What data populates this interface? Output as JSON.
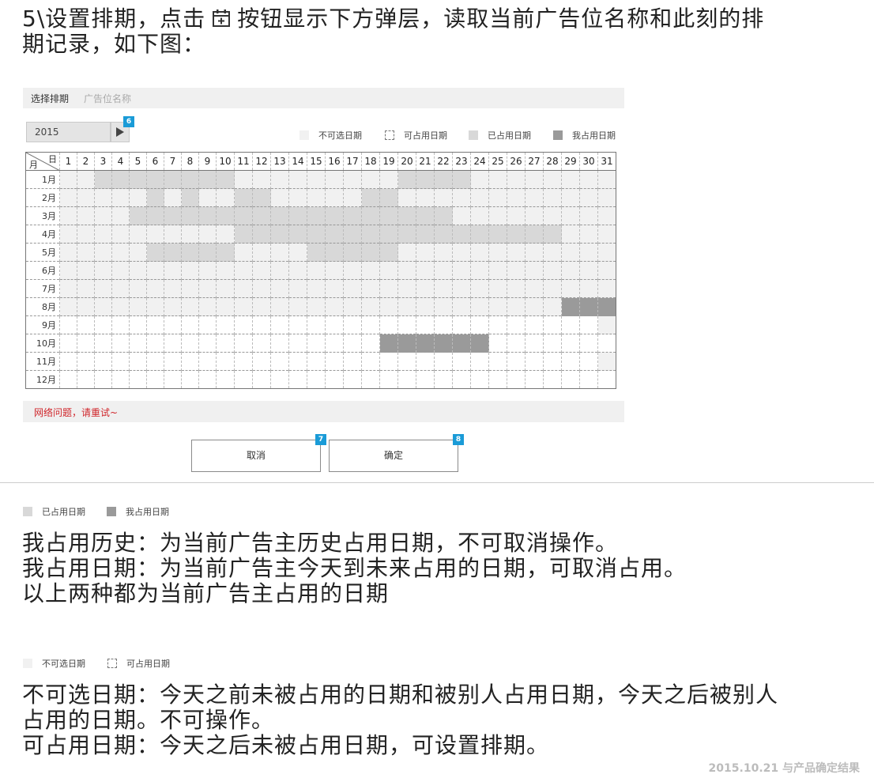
{
  "heading": {
    "step_text": "5\\设置排期，点击",
    "after_icon_text": "按钮显示下方弹层，读取当前广告位名称和此刻的排",
    "line2": "期记录，如下图：",
    "icon": "calendar-plus-icon"
  },
  "popup": {
    "select_label": "选择排期",
    "ad_slot_placeholder": "广告位名称",
    "year": "2015",
    "next_icon": "play-right-icon",
    "badge_next": "6",
    "legend": {
      "unavailable": "不可选日期",
      "available": "可占用日期",
      "occupied": "已占用日期",
      "mine": "我占用日期"
    },
    "grid": {
      "corner_day": "日",
      "corner_month": "月",
      "days": [
        "1",
        "2",
        "3",
        "4",
        "5",
        "6",
        "7",
        "8",
        "9",
        "10",
        "11",
        "12",
        "13",
        "14",
        "15",
        "16",
        "17",
        "18",
        "19",
        "20",
        "21",
        "22",
        "23",
        "24",
        "25",
        "26",
        "27",
        "28",
        "29",
        "30",
        "31"
      ],
      "months": [
        "1月",
        "2月",
        "3月",
        "4月",
        "5月",
        "6月",
        "7月",
        "8月",
        "9月",
        "10月",
        "11月",
        "12月"
      ],
      "rows": [
        "NNOOOOOOOONNNNNNNNNOOOONNNNNNNN",
        "NNNNNONONNOONNNNNOONNNNNNNNNNNN",
        "NNNNOOOOOOOOOOOOOOOOOONNNNNNNNN",
        "NNNNNNNNNNOOOOOOOOOOOOOOOOOONNN",
        "NNNNNOOOOONNNNOOOOONNNNNNNNNNNN",
        "NNNNNNNNNNNNNNNNNNNNNNNNNNNNNNN",
        "NNNNNNNNNNNNNNNNNNNNNNNNNNNNNNN",
        "NNNNNNNNNNNNNNNNNNNNNNNNNNNNMMM",
        "AAAAAAAAAAAAAAAAAAAAAAAAAAAAAAN",
        "AAAAAAAAAAAAAAAAAAMMMMMMAAAAAAA",
        "AAAAAAAAAAAAAAAAAAAAAAAAAAAAAAN",
        "AAAAAAAAAAAAAAAAAAAAAAAAAAAAAAA"
      ]
    },
    "error_text": "网络问题，请重试~",
    "cancel_label": "取消",
    "confirm_label": "确定",
    "badge_cancel": "7",
    "badge_confirm": "8"
  },
  "explain1": {
    "legend_occupied": "已占用日期",
    "legend_mine": "我占用日期",
    "lines": [
      "我占用历史：为当前广告主历史占用日期，不可取消操作。",
      "我占用日期：为当前广告主今天到未来占用的日期，可取消占用。",
      "以上两种都为当前广告主占用的日期"
    ]
  },
  "explain2": {
    "legend_unavailable": "不可选日期",
    "legend_available": "可占用日期",
    "lines": [
      "不可选日期：今天之前未被占用的日期和被别人占用日期，今天之后被别人",
      "占用的日期。不可操作。",
      "可占用日期：今天之后未被占用日期，可设置排期。"
    ]
  },
  "footer_note": "2015.10.21 与产品确定结果",
  "colors": {
    "unavailable": "#f1f1f1",
    "available": "#ffffff",
    "occupied": "#d8d8d8",
    "mine": "#9a9a9a",
    "badge": "#1a9bd7",
    "error": "#d0262b"
  }
}
